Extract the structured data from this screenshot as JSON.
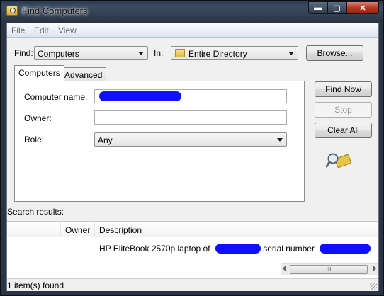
{
  "window": {
    "title": "Find Computers",
    "caption_buttons": {
      "minimize": "▬",
      "maximize": "▢",
      "close": "✕"
    }
  },
  "menu": [
    "File",
    "Edit",
    "View"
  ],
  "find_row": {
    "find_label": "Find:",
    "find_value": "Computers",
    "in_label": "In:",
    "in_value": "Entire Directory",
    "browse_label": "Browse..."
  },
  "tabs": [
    "Computers",
    "Advanced"
  ],
  "form": {
    "computer_name_label": "Computer name:",
    "owner_label": "Owner:",
    "role_label": "Role:",
    "role_value": "Any"
  },
  "actions": {
    "find_now": "Find Now",
    "stop": "Stop",
    "clear_all": "Clear All"
  },
  "results": {
    "label": "Search results:",
    "columns": [
      "",
      "Owner",
      "Description"
    ],
    "row": {
      "description_prefix": "HP EliteBook 2570p laptop of",
      "description_middle": "serial number"
    }
  },
  "scrollbar": {
    "thumb_grip": "III"
  },
  "status": {
    "text": "1 item(s) found"
  },
  "colors": {
    "redaction": "#1010ff",
    "close_button": "#b23a22"
  }
}
